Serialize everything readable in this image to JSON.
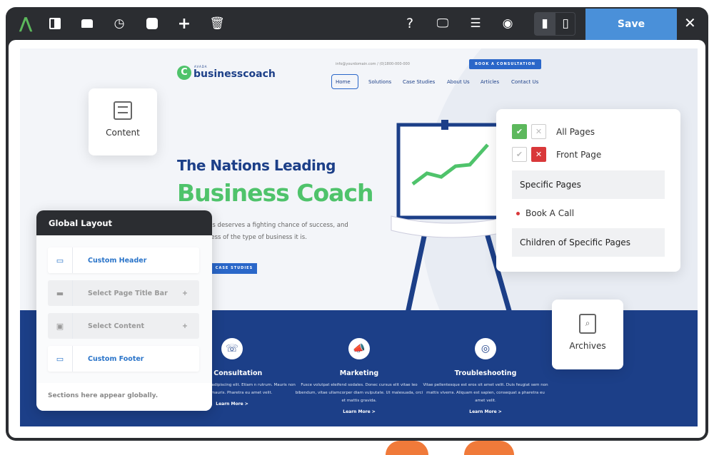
{
  "toolbar": {
    "left_icons": [
      "avada-logo",
      "layout-icon",
      "header-icon",
      "history-icon",
      "toggle-icon",
      "plus-icon",
      "trash-icon"
    ],
    "right_icons": [
      "help-icon",
      "desktop-icon",
      "sections-icon",
      "preview-icon",
      "page-icon-active",
      "page-icon"
    ],
    "save_label": "Save",
    "close_label": "✕",
    "accent": "#4a90d9"
  },
  "site": {
    "logo_small": "AVADA",
    "logo": "businesscoach",
    "contact": "info@yourdomain.com / (0)1800-000-000",
    "cta": "BOOK A CONSULTATION",
    "nav": [
      "Home",
      "Solutions",
      "Case Studies",
      "About Us",
      "Articles",
      "Contact Us"
    ],
    "hero_line1": "The Nations Leading",
    "hero_line2": "Business Coach",
    "body1": "ss deserves a fighting chance of success, and",
    "body2": "less of the type of business it is.",
    "hero_button": "CASE STUDIES",
    "services": [
      {
        "title": "ne Consultation",
        "text": "sit amet, consectetur adipiscing elit. Etiam n rutrum. Mauris non hendrerit mauris. Pharetra eu amet velit.",
        "link": "Learn More >",
        "icon": "☏"
      },
      {
        "title": "Marketing",
        "text": "Fusce volutpat eleifend sodales. Donec cursus elit vitae leo bibendum, vitae ullamcorper diam vulputate. Ut malesuada, orci et mattis gravida.",
        "link": "Learn More >",
        "icon": "📣"
      },
      {
        "title": "Troubleshooting",
        "text": "Vitae pellentesque est eros sit amet velit. Duis feugiat sem non mattis viverra. Aliquam est sapien, consequat a pharetra eu amet velit.",
        "link": "Learn More >",
        "icon": "◎"
      }
    ]
  },
  "content_card": {
    "label": "Content",
    "icon": "content-icon"
  },
  "archives_card": {
    "label": "Archives",
    "icon": "archives-icon"
  },
  "global_layout": {
    "title": "Global Layout",
    "rows": [
      {
        "label": "Custom Header",
        "active": true
      },
      {
        "label": "Select Page Title Bar",
        "active": false
      },
      {
        "label": "Select Content",
        "active": false
      },
      {
        "label": "Custom Footer",
        "active": true
      }
    ],
    "footer": "Sections here appear globally."
  },
  "conditions": {
    "all_pages": "All Pages",
    "front_page": "Front Page",
    "specific_pages": "Specific Pages",
    "book_a_call": "Book A Call",
    "children": "Children of Specific Pages"
  }
}
